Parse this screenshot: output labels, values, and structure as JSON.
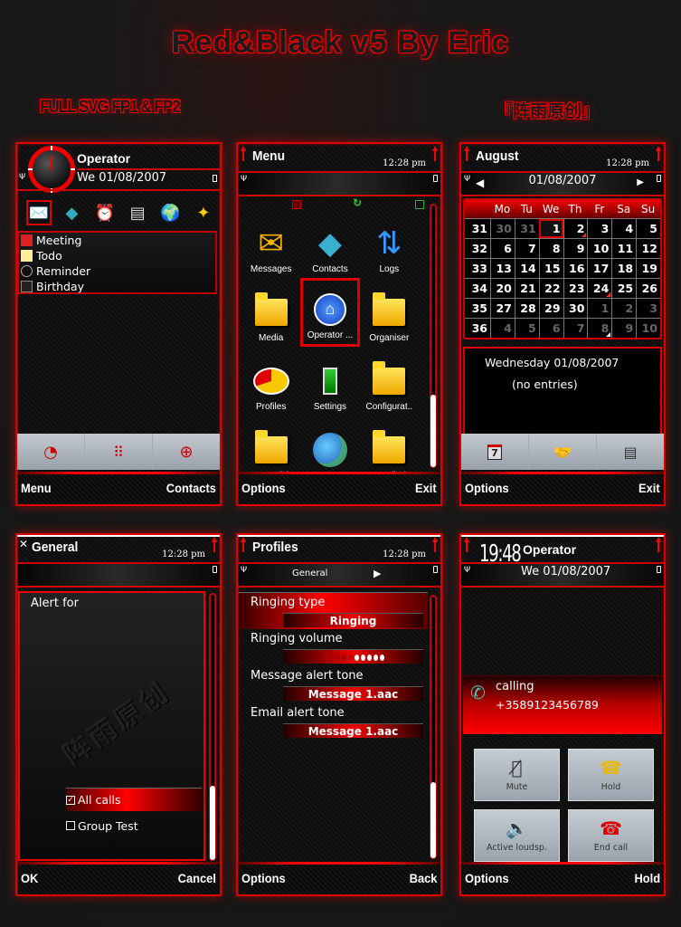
{
  "banner": {
    "title": "Red&Black v5   By Eric",
    "subtitle_left": "FULL SVG  FP1 & FP2",
    "subtitle_right": "『阵雨原创』"
  },
  "colors": {
    "accent": "#e00000",
    "background": "#161616",
    "text": "#ffffff"
  },
  "screens": {
    "home": {
      "operator": "Operator",
      "date": "We 01/08/2007",
      "shortcuts": [
        "messages-icon",
        "contacts-icon",
        "clock-icon",
        "calendar-icon",
        "globe-icon",
        "themes-icon"
      ],
      "events": [
        {
          "label": "Meeting",
          "icon": "meeting-icon"
        },
        {
          "label": "Todo",
          "icon": "todo-icon"
        },
        {
          "label": "Reminder",
          "icon": "reminder-icon"
        },
        {
          "label": "Birthday",
          "icon": "birthday-icon"
        }
      ],
      "toolbar": [
        "logo-icon",
        "dialpad-icon",
        "contacts-grid-icon"
      ],
      "softkeys": {
        "left": "Menu",
        "right": "Contacts"
      }
    },
    "menu": {
      "title": "Menu",
      "time": "12:28 pm",
      "items": [
        {
          "label": "Messages",
          "icon": "✉"
        },
        {
          "label": "Contacts",
          "icon": "📘"
        },
        {
          "label": "Logs",
          "icon": "⇅"
        },
        {
          "label": "Media",
          "icon": "folder"
        },
        {
          "label": "Operator ...",
          "icon": "⏏"
        },
        {
          "label": "Organiser",
          "icon": "folder"
        },
        {
          "label": "Profiles",
          "icon": "◕"
        },
        {
          "label": "Settings",
          "icon": "🔧"
        },
        {
          "label": "Configurat..",
          "icon": "folder"
        },
        {
          "label": "Connectivity",
          "icon": "folder"
        },
        {
          "label": "BrowserNG",
          "icon": "🌍"
        },
        {
          "label": "Installed",
          "icon": "folder"
        }
      ],
      "selected_index": 4,
      "scroll_position": 0.8,
      "softkeys": {
        "left": "Options",
        "right": "Exit"
      }
    },
    "calendar": {
      "title": "August",
      "time": "12:28 pm",
      "date": "01/08/2007",
      "weekdays": [
        "Mo",
        "Tu",
        "We",
        "Th",
        "Fr",
        "Sa",
        "Su"
      ],
      "weeks": [
        {
          "week": "31",
          "days": [
            "30",
            "31",
            "1",
            "2",
            "3",
            "4",
            "5"
          ]
        },
        {
          "week": "32",
          "days": [
            "6",
            "7",
            "8",
            "9",
            "10",
            "11",
            "12"
          ]
        },
        {
          "week": "33",
          "days": [
            "13",
            "14",
            "15",
            "16",
            "17",
            "18",
            "19"
          ]
        },
        {
          "week": "34",
          "days": [
            "20",
            "21",
            "22",
            "23",
            "24",
            "25",
            "26"
          ]
        },
        {
          "week": "35",
          "days": [
            "27",
            "28",
            "29",
            "30",
            "1",
            "2",
            "3"
          ]
        },
        {
          "week": "36",
          "days": [
            "4",
            "5",
            "6",
            "7",
            "8",
            "9",
            "10"
          ]
        }
      ],
      "day_header": "Wednesday 01/08/2007",
      "entries_text": "(no entries)",
      "toolbar": [
        "month-view-icon",
        "meeting-new-icon",
        "note-new-icon"
      ],
      "softkeys": {
        "left": "Options",
        "right": "Exit"
      }
    },
    "general": {
      "title": "General",
      "time": "12:28 pm",
      "prompt": "Alert for",
      "watermark": "阵雨原创",
      "options": [
        {
          "label": "All calls",
          "checked": true
        },
        {
          "label": "Group Test",
          "checked": false
        }
      ],
      "scroll_position": 0.8,
      "softkeys": {
        "left": "OK",
        "right": "Cancel"
      }
    },
    "profiles": {
      "title": "Profiles",
      "time": "12:28 pm",
      "profile": "General",
      "settings": [
        {
          "label": "Ringing type",
          "value": "Ringing"
        },
        {
          "label": "Ringing volume",
          "value": ""
        },
        {
          "label": "Message alert tone",
          "value": "Message 1.aac"
        },
        {
          "label": "Email alert tone",
          "value": "Message 1.aac"
        }
      ],
      "volume_level": 5,
      "volume_max": 10,
      "softkeys": {
        "left": "Options",
        "right": "Back"
      }
    },
    "call": {
      "clock": "19:48",
      "operator": "Operator",
      "date": "We 01/08/2007",
      "status": "calling",
      "number": "+3589123456789",
      "buttons": [
        {
          "label": "Mute",
          "icon": "mute-icon"
        },
        {
          "label": "Hold",
          "icon": "hold-icon"
        },
        {
          "label": "Active loudsp.",
          "icon": "speaker-icon"
        },
        {
          "label": "End call",
          "icon": "end-call-icon"
        }
      ],
      "softkeys": {
        "left": "Options",
        "right": "Hold"
      }
    }
  }
}
